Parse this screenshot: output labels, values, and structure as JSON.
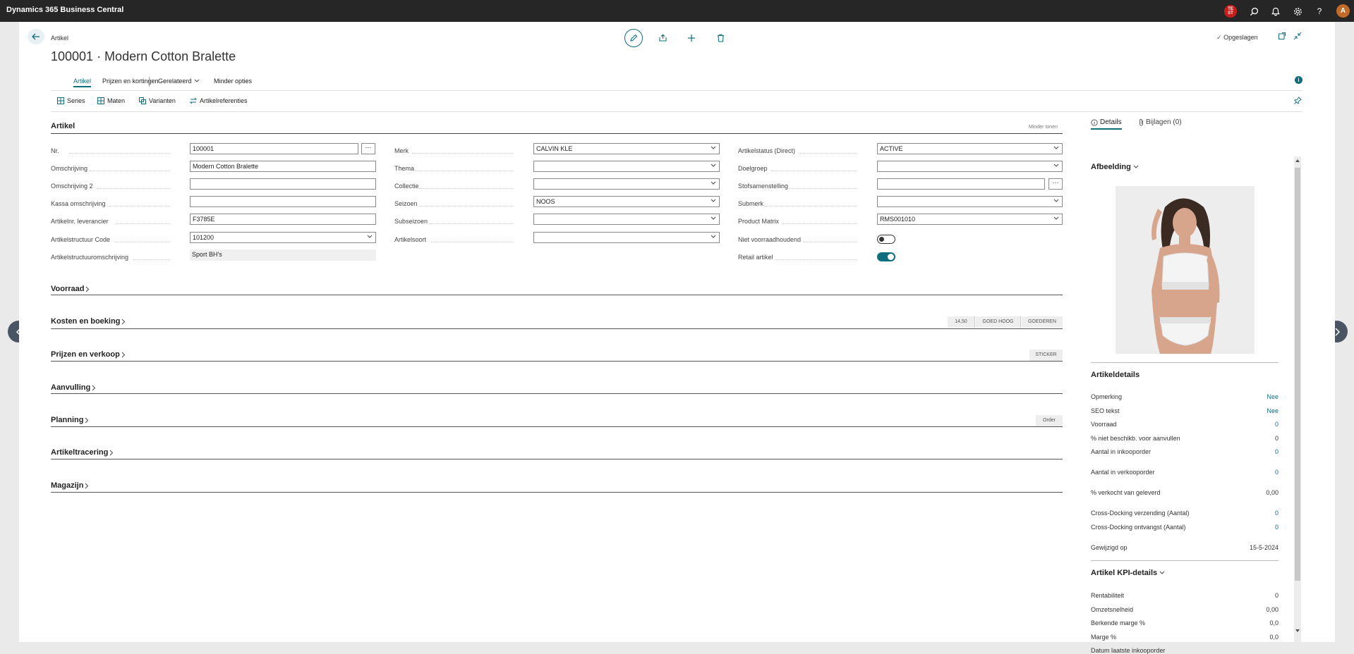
{
  "app": {
    "title": "Dynamics 365 Business Central",
    "tenant_badge": "TE ST",
    "avatar_initial": "A"
  },
  "page": {
    "breadcrumb": "Artikel",
    "title": "100001 · Modern Cotton Bralette",
    "saved_label": "Opgeslagen"
  },
  "tabs": {
    "artikel": "Artikel",
    "prijzen": "Prijzen en kortingen",
    "gerelateerd": "Gerelateerd",
    "minder": "Minder opties"
  },
  "subactions": {
    "series": "Series",
    "maten": "Maten",
    "varianten": "Varianten",
    "artikelreferenties": "Artikelreferenties"
  },
  "section": {
    "title": "Artikel",
    "toggle_label": "Minder tonen"
  },
  "fields": {
    "nr_label": "Nr.",
    "nr_value": "100001",
    "omschrijving_label": "Omschrijving",
    "omschrijving_value": "Modern Cotton Bralette",
    "omschrijving2_label": "Omschrijving 2",
    "kassa_label": "Kassa omschrijving",
    "leverancier_label": "Artikelnr. leverancier",
    "leverancier_value": "F3785E",
    "structuur_label": "Artikelstructuur Code",
    "structuur_value": "101200",
    "structuuromschr_label": "Artikelstructuuromschrijving",
    "structuuromschr_value": "Sport BH's",
    "merk_label": "Merk",
    "merk_value": "CALVIN KLE",
    "thema_label": "Thema",
    "collectie_label": "Collectie",
    "seizoen_label": "Seizoen",
    "seizoen_value": "NOOS",
    "subseizoen_label": "Subseizoen",
    "artikelsoort_label": "Artikelsoort",
    "status_label": "Artikelstatus (Direct)",
    "status_value": "ACTIVE",
    "doelgroep_label": "Doelgroep",
    "stof_label": "Stofsamenstelling",
    "submerk_label": "Submerk",
    "matrix_label": "Product Matrix",
    "matrix_value": "RMS001010",
    "nietvoorraad_label": "Niet voorraadhoudend",
    "retail_label": "Retail artikel",
    "nietvoorraad_on": false,
    "retail_on": true
  },
  "fasttabs": {
    "voorraad": "Voorraad",
    "kosten": "Kosten en boeking",
    "kosten_pills": [
      "14,50",
      "GOED HOOG",
      "GOEDEREN"
    ],
    "prijzen": "Prijzen en verkoop",
    "prijzen_pill": "STICKER",
    "aanvulling": "Aanvulling",
    "planning": "Planning",
    "planning_pill": "Order",
    "tracering": "Artikeltracering",
    "magazijn": "Magazijn"
  },
  "factbox": {
    "tab_details": "Details",
    "tab_bijlagen": "Bijlagen (0)",
    "afbeelding": "Afbeelding",
    "artikeldetails": "Artikeldetails",
    "details": [
      {
        "label": "Opmerking",
        "value": "Nee",
        "link": true
      },
      {
        "label": "SEO tekst",
        "value": "Nee",
        "link": true
      },
      {
        "label": "Voorraad",
        "value": "0",
        "link": true
      },
      {
        "label": "% niet beschikb. voor aanvullen",
        "value": "0",
        "link": false
      },
      {
        "label": "Aantal in inkooporder",
        "value": "0",
        "link": true
      },
      {
        "label": "Aantal in verkooporder",
        "value": "0",
        "link": true
      },
      {
        "label": "% verkocht van geleverd",
        "value": "0,00",
        "link": false
      },
      {
        "label": "Cross-Docking verzending (Aantal)",
        "value": "0",
        "link": true
      },
      {
        "label": "Cross-Docking ontvangst (Aantal)",
        "value": "0",
        "link": true
      },
      {
        "label": "Gewijzigd op",
        "value": "15-5-2024",
        "link": false
      }
    ],
    "kpi_title": "Artikel KPI-details",
    "kpi": [
      {
        "label": "Rentabiliteit",
        "value": "0"
      },
      {
        "label": "Omzetsnelheid",
        "value": "0,00"
      },
      {
        "label": "Berkende marge %",
        "value": "0,0"
      },
      {
        "label": "Marge %",
        "value": "0,0"
      },
      {
        "label": "Datum laatste inkooporder",
        "value": ""
      }
    ]
  },
  "colors": {
    "accent": "#0f6e7e",
    "topbar": "#262626",
    "badge": "#c81e1e"
  }
}
